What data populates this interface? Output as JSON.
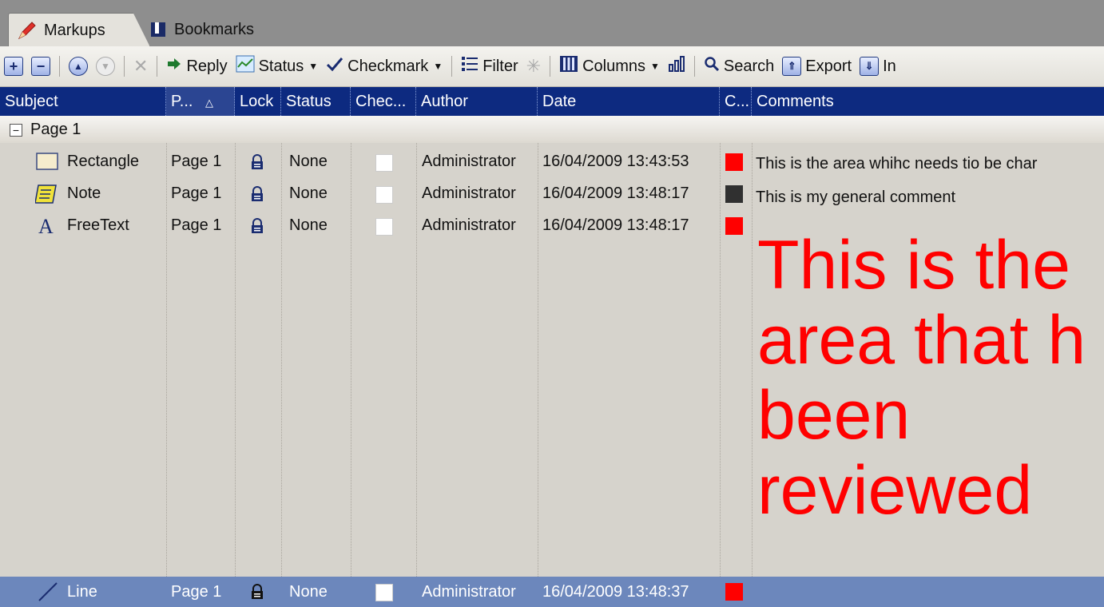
{
  "tabs": [
    {
      "label": "Markups",
      "icon": "pencil-icon",
      "active": true
    },
    {
      "label": "Bookmarks",
      "icon": "bookmark-icon",
      "active": false
    }
  ],
  "toolbar": {
    "reply_label": "Reply",
    "status_label": "Status",
    "checkmark_label": "Checkmark",
    "filter_label": "Filter",
    "columns_label": "Columns",
    "search_label": "Search",
    "export_label": "Export",
    "import_label": "In"
  },
  "columns": {
    "subject": "Subject",
    "page": "P...",
    "lock": "Lock",
    "status": "Status",
    "checkmark": "Chec...",
    "author": "Author",
    "date": "Date",
    "color": "C...",
    "comments": "Comments"
  },
  "group": {
    "label": "Page 1",
    "expander": "−"
  },
  "rows": [
    {
      "subject": "Rectangle",
      "icon": "rectangle-icon",
      "page": "Page 1",
      "status": "None",
      "author": "Administrator",
      "date": "16/04/2009 13:43:53",
      "color": "#ff0000",
      "comment": "This is the area whihc needs tio be char"
    },
    {
      "subject": "Note",
      "icon": "note-icon",
      "page": "Page 1",
      "status": "None",
      "author": "Administrator",
      "date": "16/04/2009 13:48:17",
      "color": "#303030",
      "comment": "This is my general comment"
    },
    {
      "subject": "FreeText",
      "icon": "freetext-icon",
      "page": "Page 1",
      "status": "None",
      "author": "Administrator",
      "date": "16/04/2009 13:48:17",
      "color": "#ff0000",
      "comment_lines": [
        "This is the",
        "area that h",
        "been",
        "reviewed"
      ]
    }
  ],
  "selected_row": {
    "subject": "Line",
    "icon": "line-icon",
    "page": "Page 1",
    "status": "None",
    "author": "Administrator",
    "date": "16/04/2009 13:48:37",
    "color": "#ff0000"
  },
  "colors": {
    "header_bg": "#0d2a80",
    "selected_bg": "#6c87bc",
    "freetext_red": "#ff0000"
  }
}
